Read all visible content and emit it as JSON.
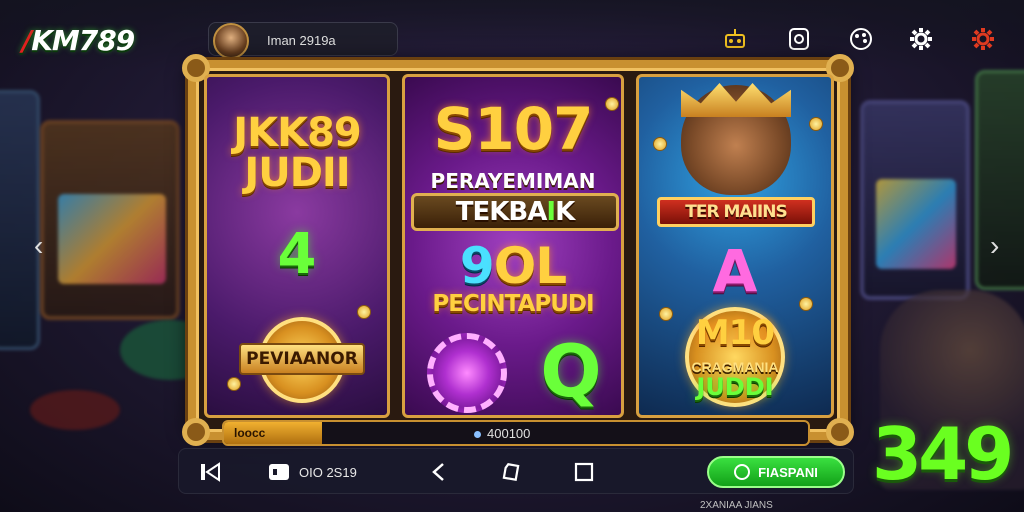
{
  "header": {
    "logo_prefix": "",
    "logo_text": "KM789",
    "profile_name": "Iman 2919a",
    "icons": [
      "robot-icon",
      "chip-icon",
      "palette-icon",
      "gear-icon",
      "settings-red-icon"
    ]
  },
  "panels": {
    "left": {
      "title_line1": "JKK89",
      "title_line2": "JUDII",
      "number": "4",
      "badge_label": "PEVIAANOR"
    },
    "center": {
      "amount": "S107",
      "subtitle": "PERAYEMIMAN",
      "ribbon_main": "TEKBA",
      "ribbon_accent": "I",
      "ribbon_end": "K",
      "mid_a": "9",
      "mid_b": "OL",
      "caption": "PECINTAPUDI",
      "chip_letter": "Q"
    },
    "right": {
      "ribbon": "TER MAIINS",
      "letter": "A",
      "badge_num": "M10",
      "badge_line1": "CRAGMANIA",
      "badge_line2": "JUDDI"
    }
  },
  "frame_bar": {
    "left_label": "loocc",
    "center_value": "400100"
  },
  "bottom_bar": {
    "stat_value": "OIO 2S19",
    "play_label": "FIASPANI"
  },
  "counter": "349",
  "footnote": "2XANIAA JIANS",
  "colors": {
    "accent_green": "#6aff20",
    "gold": "#c89030",
    "logo_red": "#e02020"
  }
}
